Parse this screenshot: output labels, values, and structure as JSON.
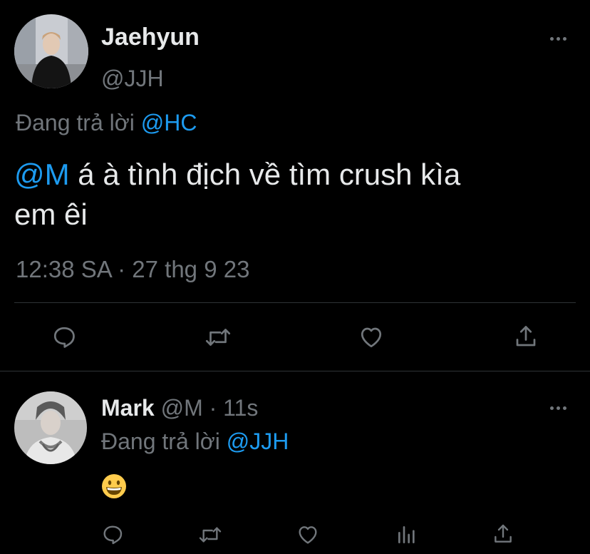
{
  "main_tweet": {
    "author_name": "Jaehyun",
    "author_handle": "@JJH",
    "reply_prefix": "Đang trả lời",
    "reply_to": "@HC",
    "mention": "@M",
    "text_line1": "á à tình địch về tìm crush kìa",
    "text_line2": "em êi",
    "timestamp": "12:38 SA · 27 thg 9 23"
  },
  "reply_tweet": {
    "author_name": "Mark",
    "author_handle": "@M",
    "separator": "·",
    "time": "11s",
    "reply_prefix": "Đang trả lời",
    "reply_to": "@JJH",
    "emoji": "😀"
  },
  "icons": {
    "main_actions": [
      "reply-icon",
      "retweet-icon",
      "like-icon",
      "share-icon"
    ],
    "reply_actions": [
      "reply-icon",
      "retweet-icon",
      "like-icon",
      "analytics-icon",
      "share-icon"
    ],
    "more": "more-dots-icon"
  },
  "colors": {
    "background": "#000000",
    "text": "#e7e9ea",
    "muted": "#71767b",
    "accent": "#1d9bf0",
    "divider": "#2f3336"
  }
}
